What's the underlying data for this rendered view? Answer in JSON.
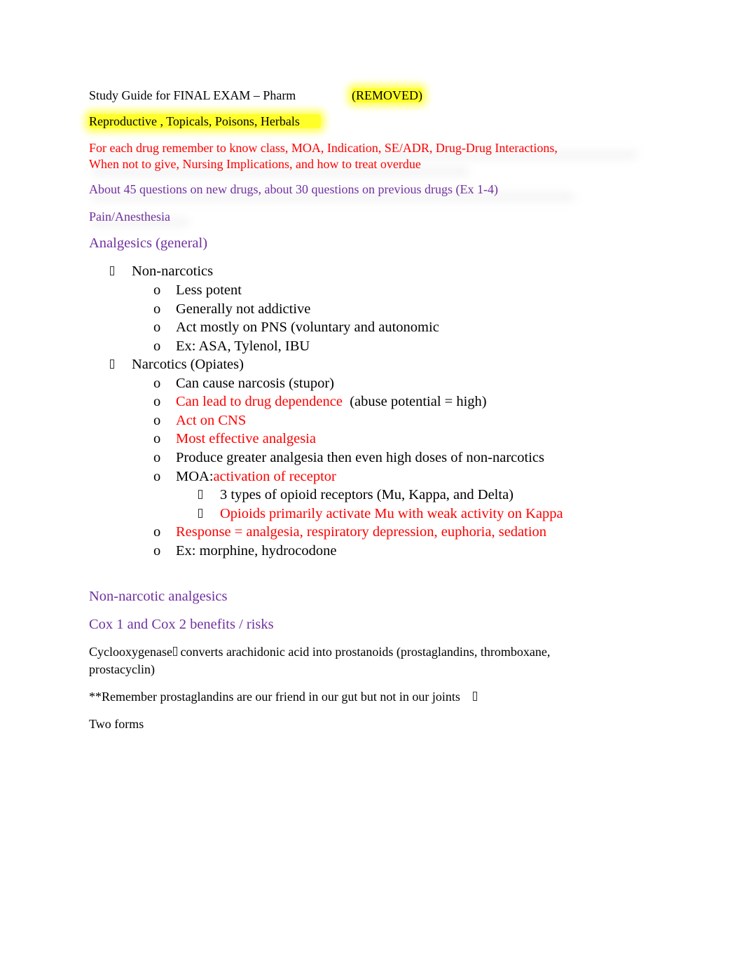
{
  "document": {
    "title": "Study Guide for FINAL EXAM – Pharm",
    "removed_tag": "(REMOVED)",
    "subtitle": "Reproductive , Topicals, Poisons, Herbals",
    "instructions_line1": "For each drug remember to know class, MOA, Indication, SE/ADR, Drug-Drug Interactions,",
    "instructions_line2": "When not to give, Nursing Implications, and how to treat overdue",
    "question_note": "About 45 questions on new drugs, about 30 questions on previous drugs (Ex 1-4)",
    "section_heading": "Pain/Anesthesia",
    "subsection_heading": "Analgesics (general)",
    "outline": [
      {
        "label": "Non-narcotics",
        "bullet_icon": "square-bullet",
        "children": [
          {
            "label": "Less potent",
            "bullet": "o"
          },
          {
            "label": "Generally not addictive",
            "bullet": "o"
          },
          {
            "label": "Act mostly on PNS (voluntary and autonomic",
            "bullet": "o"
          },
          {
            "label": "Ex: ASA, Tylenol, IBU",
            "bullet": "o"
          }
        ]
      },
      {
        "label": "Narcotics (Opiates)",
        "bullet_icon": "square-bullet",
        "children": [
          {
            "label": "Can cause narcosis (stupor)",
            "bullet": "o"
          },
          {
            "label_red": "Can lead to drug dependence",
            "label_black": "(abuse potential = high)",
            "bullet": "o"
          },
          {
            "label": "Act on CNS",
            "bullet": "o",
            "color": "red"
          },
          {
            "label": "Most effective analgesia",
            "bullet": "o",
            "color": "red"
          },
          {
            "label": "Produce greater analgesia then even high doses of non-narcotics",
            "bullet": "o"
          },
          {
            "label_black": "MOA:",
            "label_red": "activation of receptor",
            "bullet": "o",
            "children": [
              {
                "label": "3 types of opioid receptors (Mu, Kappa, and Delta)",
                "bullet_icon": "square-bullet"
              },
              {
                "label": "Opioids primarily activate Mu with weak activity on Kappa",
                "bullet_icon": "square-bullet",
                "color": "red"
              }
            ]
          },
          {
            "label": "Response = analgesia, respiratory depression, euphoria, sedation",
            "bullet": "o",
            "color": "red"
          },
          {
            "label": "Ex: morphine, hydrocodone",
            "bullet": "o"
          }
        ]
      }
    ],
    "nonnarcotic_heading": "Non-narcotic analgesics",
    "cox_heading": "Cox 1 and Cox 2 benefits / risks",
    "cox_para_line1": "Cyclooxygenase",
    "cox_para_line1_rest": " converts arachidonic acid into prostanoids (prostaglandins, thromboxane,",
    "cox_para_line2": "prostacyclin)",
    "remember_note": "**Remember prostaglandins are our friend in our gut but not in our joints",
    "two_forms": "Two forms"
  },
  "colors": {
    "red": "#ff0000",
    "purple": "#7030a0",
    "highlight": "#ffff2a",
    "text": "#000000"
  }
}
